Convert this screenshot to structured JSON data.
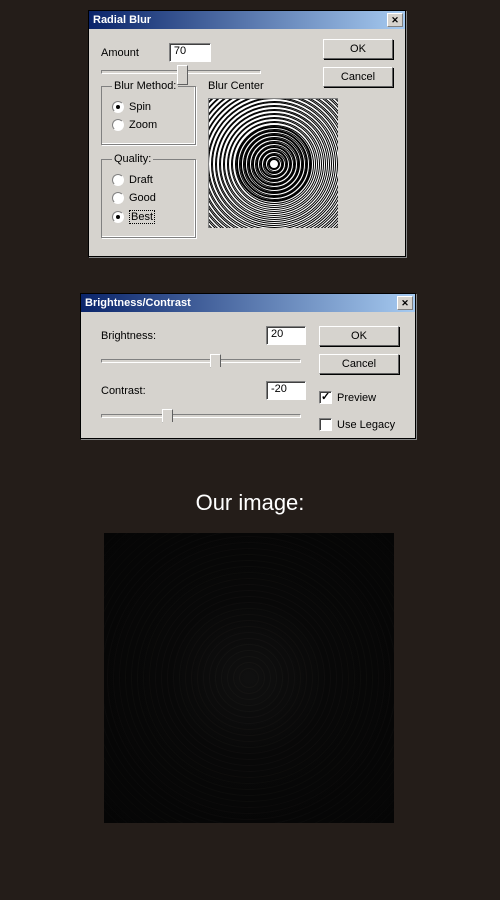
{
  "radial_blur": {
    "title": "Radial Blur",
    "amount_label": "Amount",
    "amount_value": "70",
    "ok_label": "OK",
    "cancel_label": "Cancel",
    "method_legend": "Blur Method:",
    "method_spin": "Spin",
    "method_zoom": "Zoom",
    "quality_legend": "Quality:",
    "quality_draft": "Draft",
    "quality_good": "Good",
    "quality_best": "Best",
    "center_label": "Blur Center"
  },
  "brightness_contrast": {
    "title": "Brightness/Contrast",
    "brightness_label": "Brightness:",
    "brightness_value": "20",
    "contrast_label": "Contrast:",
    "contrast_value": "-20",
    "ok_label": "OK",
    "cancel_label": "Cancel",
    "preview_label": "Preview",
    "legacy_label": "Use Legacy"
  },
  "footer": {
    "caption": "Our image:"
  }
}
